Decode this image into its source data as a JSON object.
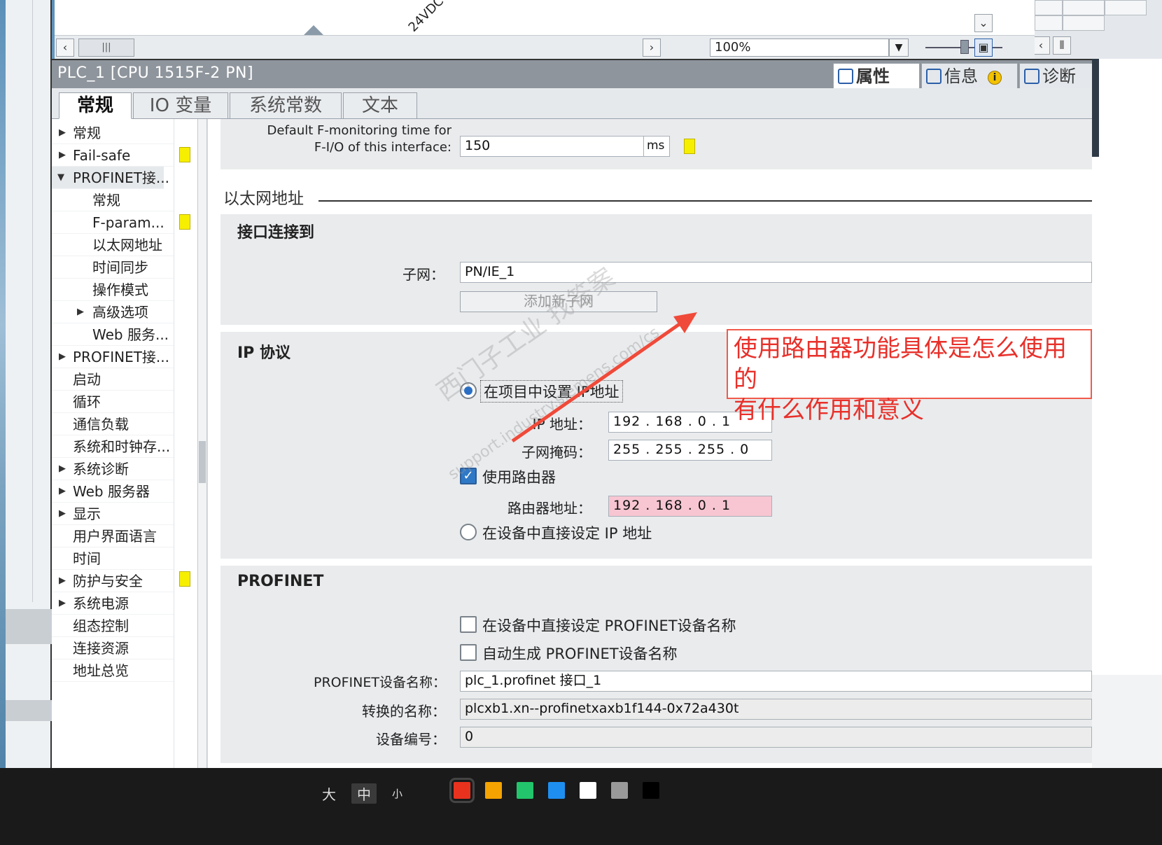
{
  "canvas": {
    "rotated_label": "24VDC"
  },
  "zoom": {
    "value": "100%"
  },
  "window": {
    "title": "PLC_1 [CPU 1515F-2 PN]"
  },
  "right_tabs": {
    "properties": "属性",
    "info": "信息",
    "diagnostics": "诊断"
  },
  "tabs": {
    "general": "常规",
    "io_vars": "IO 变量",
    "sys_consts": "系统常数",
    "text": "文本"
  },
  "nav": {
    "general": "常规",
    "failsafe": "Fail-safe",
    "profinet1": "PROFINET接...",
    "pn_general": "常规",
    "fparam": "F-param...",
    "ethernet": "以太网地址",
    "timesync": "时间同步",
    "opmode": "操作模式",
    "advanced": "高级选项",
    "webservice": "Web 服务...",
    "profinet2": "PROFINET接...",
    "startup": "启动",
    "cycle": "循环",
    "commload": "通信负载",
    "sysclock": "系统和时钟存...",
    "sysdiag": "系统诊断",
    "webserver": "Web 服务器",
    "display": "显示",
    "uilang": "用户界面语言",
    "time": "时间",
    "protection": "防护与安全",
    "syspower": "系统电源",
    "config": "组态控制",
    "connres": "连接资源",
    "addr": "地址总览"
  },
  "fmon": {
    "label1": "Default F-monitoring time for",
    "label2": "F-I/O of this interface:",
    "value": "150",
    "unit": "ms"
  },
  "ethernet": {
    "section": "以太网地址"
  },
  "iface": {
    "header": "接口连接到",
    "subnet_label": "子网：",
    "subnet_value": "PN/IE_1",
    "add_subnet": "添加新子网"
  },
  "ip": {
    "header": "IP 协议",
    "opt_project": "在项目中设置 IP地址",
    "ip_label": "IP 地址：",
    "ip_value": "192 . 168 . 0     . 1",
    "mask_label": "子网掩码：",
    "mask_value": "255 . 255 . 255 . 0",
    "use_router": "使用路由器",
    "router_label": "路由器地址：",
    "router_value": "192 . 168 . 0     . 1",
    "opt_device": "在设备中直接设定 IP 地址"
  },
  "profinet": {
    "header": "PROFINET",
    "opt_direct": "在设备中直接设定 PROFINET设备名称",
    "opt_auto": "自动生成 PROFINET设备名称",
    "name_label": "PROFINET设备名称：",
    "name_value": "plc_1.profinet 接口_1",
    "conv_label": "转换的名称：",
    "conv_value": "plcxb1.xn--profinetxaxb1f144-0x72a430t",
    "devno_label": "设备编号：",
    "devno_value": "0"
  },
  "callout": {
    "line1": "使用路由器功能具体是怎么使用的",
    "line2": "有什么作用和意义"
  },
  "watermark": {
    "line1": "西门子工业  找答案",
    "line2": "support.industry.siemens.com/cs"
  },
  "bottom": {
    "sizes": [
      "大",
      "中",
      "小"
    ],
    "colors": [
      "#e8321e",
      "#f5a300",
      "#22c56b",
      "#1e8ff0",
      "#ffffff",
      "#9a9a9a",
      "#000000"
    ]
  },
  "accent": {
    "yellow_marker": "#f7ef00",
    "callout": "#e8302a",
    "router_field": "#f7c6d2"
  }
}
